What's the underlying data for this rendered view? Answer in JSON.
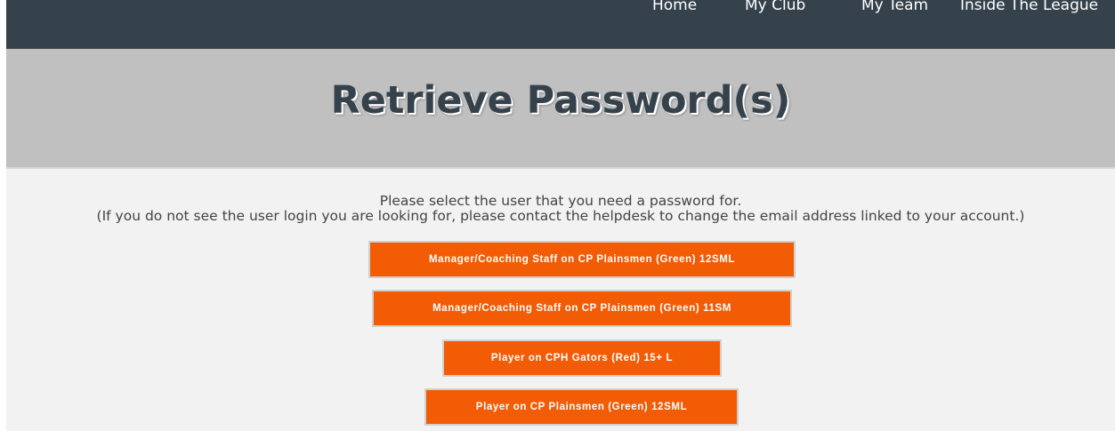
{
  "nav": {
    "items": [
      "Home",
      "My Club",
      "My Team",
      "Inside The League"
    ]
  },
  "page": {
    "title": "Retrieve Password(s)"
  },
  "instructions": {
    "line1": "Please select the user that you need a password for.",
    "line2": "(If you do not see the user login you are looking for, please contact the helpdesk to change the email address linked to your account.)"
  },
  "users": [
    {
      "label": "Manager/Coaching Staff on CP Plainsmen (Green) 12SML"
    },
    {
      "label": "Manager/Coaching Staff on CP Plainsmen (Green) 11SM"
    },
    {
      "label": "Player on CPH Gators (Red) 15+ L"
    },
    {
      "label": "Player on CP Plainsmen (Green) 12SML"
    }
  ],
  "colors": {
    "nav_bg": "#35424c",
    "hero_bg": "#c0c0c0",
    "content_bg": "#f2f2f2",
    "button_bg": "#f25c05",
    "title_text": "#35424c"
  }
}
